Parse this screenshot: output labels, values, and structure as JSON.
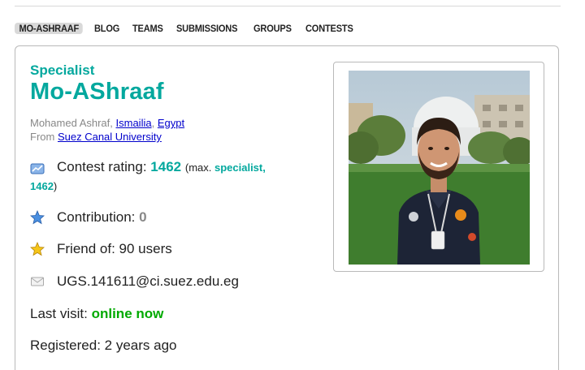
{
  "nav": {
    "tabs": [
      {
        "label": "MO-ASHRAAF",
        "active": true
      },
      {
        "label": "BLOG"
      },
      {
        "label": "TEAMS"
      },
      {
        "label": "SUBMISSIONS"
      },
      {
        "label": "GROUPS"
      },
      {
        "label": "CONTESTS"
      }
    ]
  },
  "profile": {
    "rank": "Specialist",
    "handle": "Mo-AShraaf",
    "name": "Mohamed Ashraf,",
    "city": "Ismailia",
    "comma": ",",
    "country": "Egypt",
    "from_label": "From",
    "organization": "Suez Canal University",
    "rating_label": "Contest rating:",
    "rating": "1462",
    "max_open": "(max.",
    "max_rank": "specialist,",
    "max_rating": "1462",
    "max_close": ")",
    "contribution_label": "Contribution:",
    "contribution": "0",
    "friend_label": "Friend of: 90 users",
    "email": "UGS.141611@ci.suez.edu.eg",
    "last_visit_label": "Last visit:",
    "last_visit": "online now",
    "registered_label": "Registered:",
    "registered": "2 years ago"
  },
  "colors": {
    "specialist": "#03a89e",
    "online": "#00aa00",
    "link": "#0000cc"
  },
  "icons": [
    "rating-icon",
    "star-blue-icon",
    "star-gold-icon",
    "envelope-icon"
  ]
}
